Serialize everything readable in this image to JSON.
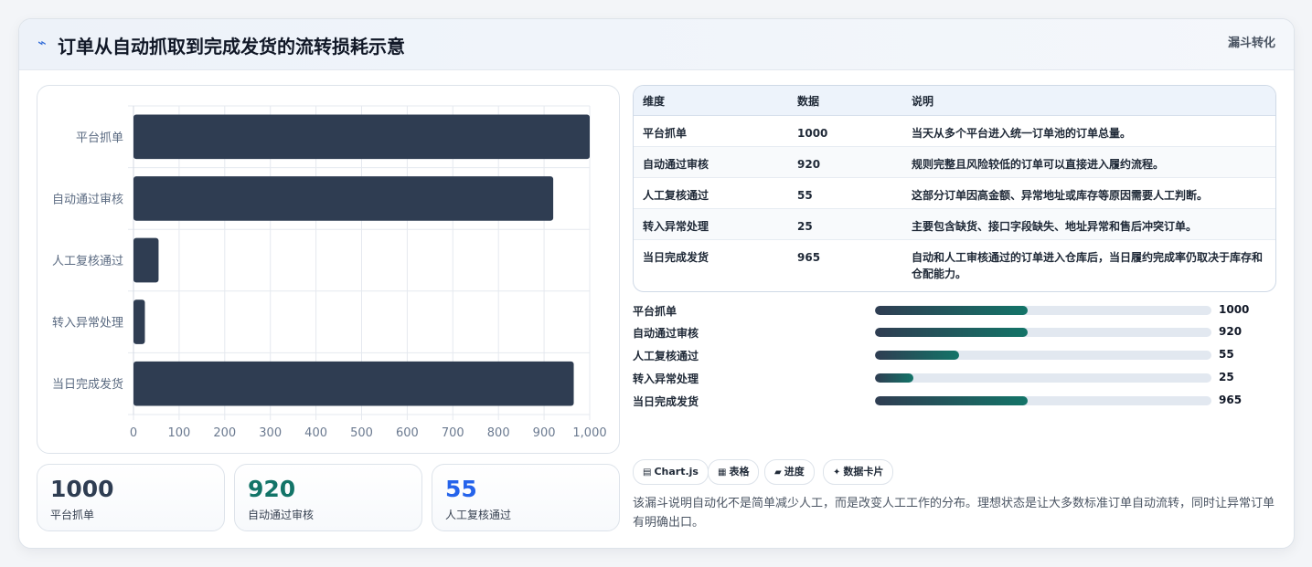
{
  "header": {
    "icon": "line-chart-icon",
    "title": "订单从自动抓取到完成发货的流转损耗示意",
    "tag": "漏斗转化"
  },
  "colors": {
    "bar": "#2f3d52",
    "accent_blue": "#2f6bd8",
    "accent_green": "#137468",
    "track": "#e2e8f0"
  },
  "chart_data": {
    "type": "bar",
    "orientation": "horizontal",
    "categories": [
      "平台抓单",
      "自动通过审核",
      "人工复核通过",
      "转入异常处理",
      "当日完成发货"
    ],
    "values": [
      1000,
      920,
      55,
      25,
      965
    ],
    "xlim": [
      0,
      1000
    ],
    "x_ticks": [
      "0",
      "100",
      "200",
      "300",
      "400",
      "500",
      "600",
      "700",
      "800",
      "900",
      "1,000"
    ],
    "grid": true
  },
  "stats": [
    {
      "value": "1000",
      "label": "平台抓单",
      "color": "#2f3d52"
    },
    {
      "value": "920",
      "label": "自动通过审核",
      "color": "#137468"
    },
    {
      "value": "55",
      "label": "人工复核通过",
      "color": "#2563eb"
    }
  ],
  "table": {
    "headers": [
      "维度",
      "数据",
      "说明"
    ],
    "rows": [
      {
        "dim": "平台抓单",
        "value": "1000",
        "desc": "当天从多个平台进入统一订单池的订单总量。"
      },
      {
        "dim": "自动通过审核",
        "value": "920",
        "desc": "规则完整且风险较低的订单可以直接进入履约流程。"
      },
      {
        "dim": "人工复核通过",
        "value": "55",
        "desc": "这部分订单因高金额、异常地址或库存等原因需要人工判断。"
      },
      {
        "dim": "转入异常处理",
        "value": "25",
        "desc": "主要包含缺货、接口字段缺失、地址异常和售后冲突订单。"
      },
      {
        "dim": "当日完成发货",
        "value": "965",
        "desc": "自动和人工审核通过的订单进入仓库后，当日履约完成率仍取决于库存和仓配能力。"
      }
    ]
  },
  "progress": [
    {
      "label": "平台抓单",
      "value": "1000",
      "fill_pct": 45.5
    },
    {
      "label": "自动通过审核",
      "value": "920",
      "fill_pct": 45.5
    },
    {
      "label": "人工复核通过",
      "value": "55",
      "fill_pct": 25
    },
    {
      "label": "转入异常处理",
      "value": "25",
      "fill_pct": 11.4
    },
    {
      "label": "当日完成发货",
      "value": "965",
      "fill_pct": 45.5
    }
  ],
  "chips": [
    {
      "icon": "▤",
      "icon_name": "chart-icon",
      "label": "Chart.js"
    },
    {
      "icon": "▦",
      "icon_name": "table-icon",
      "label": "表格"
    },
    {
      "icon": "▰",
      "icon_name": "progress-icon",
      "label": "进度"
    },
    {
      "icon": "✦",
      "icon_name": "sparkle-icon",
      "label": "数据卡片"
    }
  ],
  "footnote": "该漏斗说明自动化不是简单减少人工，而是改变人工工作的分布。理想状态是让大多数标准订单自动流转，同时让异常订单有明确出口。"
}
